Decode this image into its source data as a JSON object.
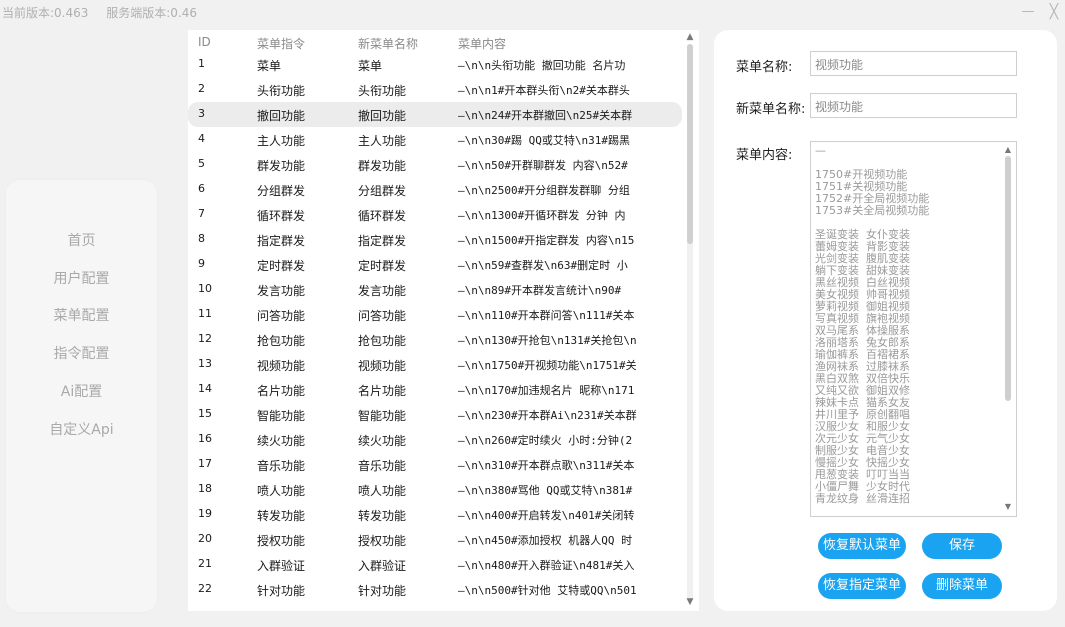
{
  "header": {
    "current_version": "当前版本:0.463",
    "server_version": "服务端版本:0.46",
    "minimize_glyph": "—",
    "close_glyph": "╳"
  },
  "sidebar": {
    "items": [
      {
        "label": "首页"
      },
      {
        "label": "用户配置"
      },
      {
        "label": "菜单配置"
      },
      {
        "label": "指令配置"
      },
      {
        "label": "Ai配置"
      },
      {
        "label": "自定义Api"
      }
    ]
  },
  "table": {
    "columns": [
      "ID",
      "菜单指令",
      "新菜单名称",
      "菜单内容"
    ],
    "selected_row": 2,
    "rows": [
      {
        "id": "1",
        "cmd": "菜单",
        "new_name": "菜单",
        "content": "—\\n\\n头衔功能 撤回功能 名片功"
      },
      {
        "id": "2",
        "cmd": "头衔功能",
        "new_name": "头衔功能",
        "content": "—\\n\\n1#开本群头衔\\n2#关本群头"
      },
      {
        "id": "3",
        "cmd": "撤回功能",
        "new_name": "撤回功能",
        "content": "—\\n\\n24#开本群撤回\\n25#关本群"
      },
      {
        "id": "4",
        "cmd": "主人功能",
        "new_name": "主人功能",
        "content": "—\\n\\n30#踢 QQ或艾特\\n31#踢黑"
      },
      {
        "id": "5",
        "cmd": "群发功能",
        "new_name": "群发功能",
        "content": "—\\n\\n50#开群聊群发  内容\\n52#"
      },
      {
        "id": "6",
        "cmd": "分组群发",
        "new_name": "分组群发",
        "content": "—\\n\\n2500#开分组群发群聊 分组"
      },
      {
        "id": "7",
        "cmd": "循环群发",
        "new_name": "循环群发",
        "content": "—\\n\\n1300#开循环群发 分钟 内"
      },
      {
        "id": "8",
        "cmd": "指定群发",
        "new_name": "指定群发",
        "content": "—\\n\\n1500#开指定群发  内容\\n15"
      },
      {
        "id": "9",
        "cmd": "定时群发",
        "new_name": "定时群发",
        "content": "—\\n\\n59#查群发\\n63#删定时 小"
      },
      {
        "id": "10",
        "cmd": "发言功能",
        "new_name": "发言功能",
        "content": "—\\n\\n89#开本群发言统计\\n90#"
      },
      {
        "id": "11",
        "cmd": "问答功能",
        "new_name": "问答功能",
        "content": "—\\n\\n110#开本群问答\\n111#关本"
      },
      {
        "id": "12",
        "cmd": "抢包功能",
        "new_name": "抢包功能",
        "content": "—\\n\\n130#开抢包\\n131#关抢包\\n"
      },
      {
        "id": "13",
        "cmd": "视频功能",
        "new_name": "视频功能",
        "content": "—\\n\\n1750#开视频功能\\n1751#关"
      },
      {
        "id": "14",
        "cmd": "名片功能",
        "new_name": "名片功能",
        "content": "—\\n\\n170#加违规名片  昵称\\n171"
      },
      {
        "id": "15",
        "cmd": "智能功能",
        "new_name": "智能功能",
        "content": "—\\n\\n230#开本群Ai\\n231#关本群"
      },
      {
        "id": "16",
        "cmd": "续火功能",
        "new_name": "续火功能",
        "content": "—\\n\\n260#定时续火 小时:分钟(2"
      },
      {
        "id": "17",
        "cmd": "音乐功能",
        "new_name": "音乐功能",
        "content": "—\\n\\n310#开本群点歌\\n311#关本"
      },
      {
        "id": "18",
        "cmd": "喷人功能",
        "new_name": "喷人功能",
        "content": "—\\n\\n380#骂他 QQ或艾特\\n381#"
      },
      {
        "id": "19",
        "cmd": "转发功能",
        "new_name": "转发功能",
        "content": "—\\n\\n400#开启转发\\n401#关闭转"
      },
      {
        "id": "20",
        "cmd": "授权功能",
        "new_name": "授权功能",
        "content": "—\\n\\n450#添加授权  机器人QQ 时"
      },
      {
        "id": "21",
        "cmd": "入群验证",
        "new_name": "入群验证",
        "content": "—\\n\\n480#开入群验证\\n481#关入"
      },
      {
        "id": "22",
        "cmd": "针对功能",
        "new_name": "针对功能",
        "content": "—\\n\\n500#针对他  艾特或QQ\\n501"
      }
    ]
  },
  "form": {
    "menu_name_label": "菜单名称:",
    "menu_name_value": "视频功能",
    "new_menu_name_label": "新菜单名称:",
    "new_menu_name_value": "视频功能",
    "menu_content_label": "菜单内容:",
    "content_lines": [
      "—",
      "",
      "1750#开视频功能",
      "1751#关视频功能",
      "1752#开全局视频功能",
      "1753#关全局视频功能",
      "",
      "圣诞变装  女仆变装",
      "蕾姆变装  背影变装",
      "光剑变装  腹肌变装",
      "躺下变装  甜妹变装",
      "黑丝视频  白丝视频",
      "美女视频  帅哥视频",
      "萝莉视频  御姐视频",
      "写真视频  旗袍视频",
      "双马尾系  体操服系",
      "洛丽塔系  兔女郎系",
      "瑜伽裤系  百褶裙系",
      "渔网袜系  过膝袜系",
      "黑白双煞  双倍快乐",
      "又纯又欲  御姐双修",
      "辣妹卡点  猫系女友",
      "井川里予  原创翻唱",
      "汉服少女  和服少女",
      "次元少女  元气少女",
      "制服少女  电音少女",
      "慢摇少女  快摇少女",
      "甩葱变装  叮叮当当",
      "小僵尸舞  少女时代",
      "青龙纹身  丝滑连招"
    ],
    "buttons": {
      "restore_default": "恢复默认菜单",
      "save": "保存",
      "restore_specified": "恢复指定菜单",
      "delete": "删除菜单"
    }
  }
}
